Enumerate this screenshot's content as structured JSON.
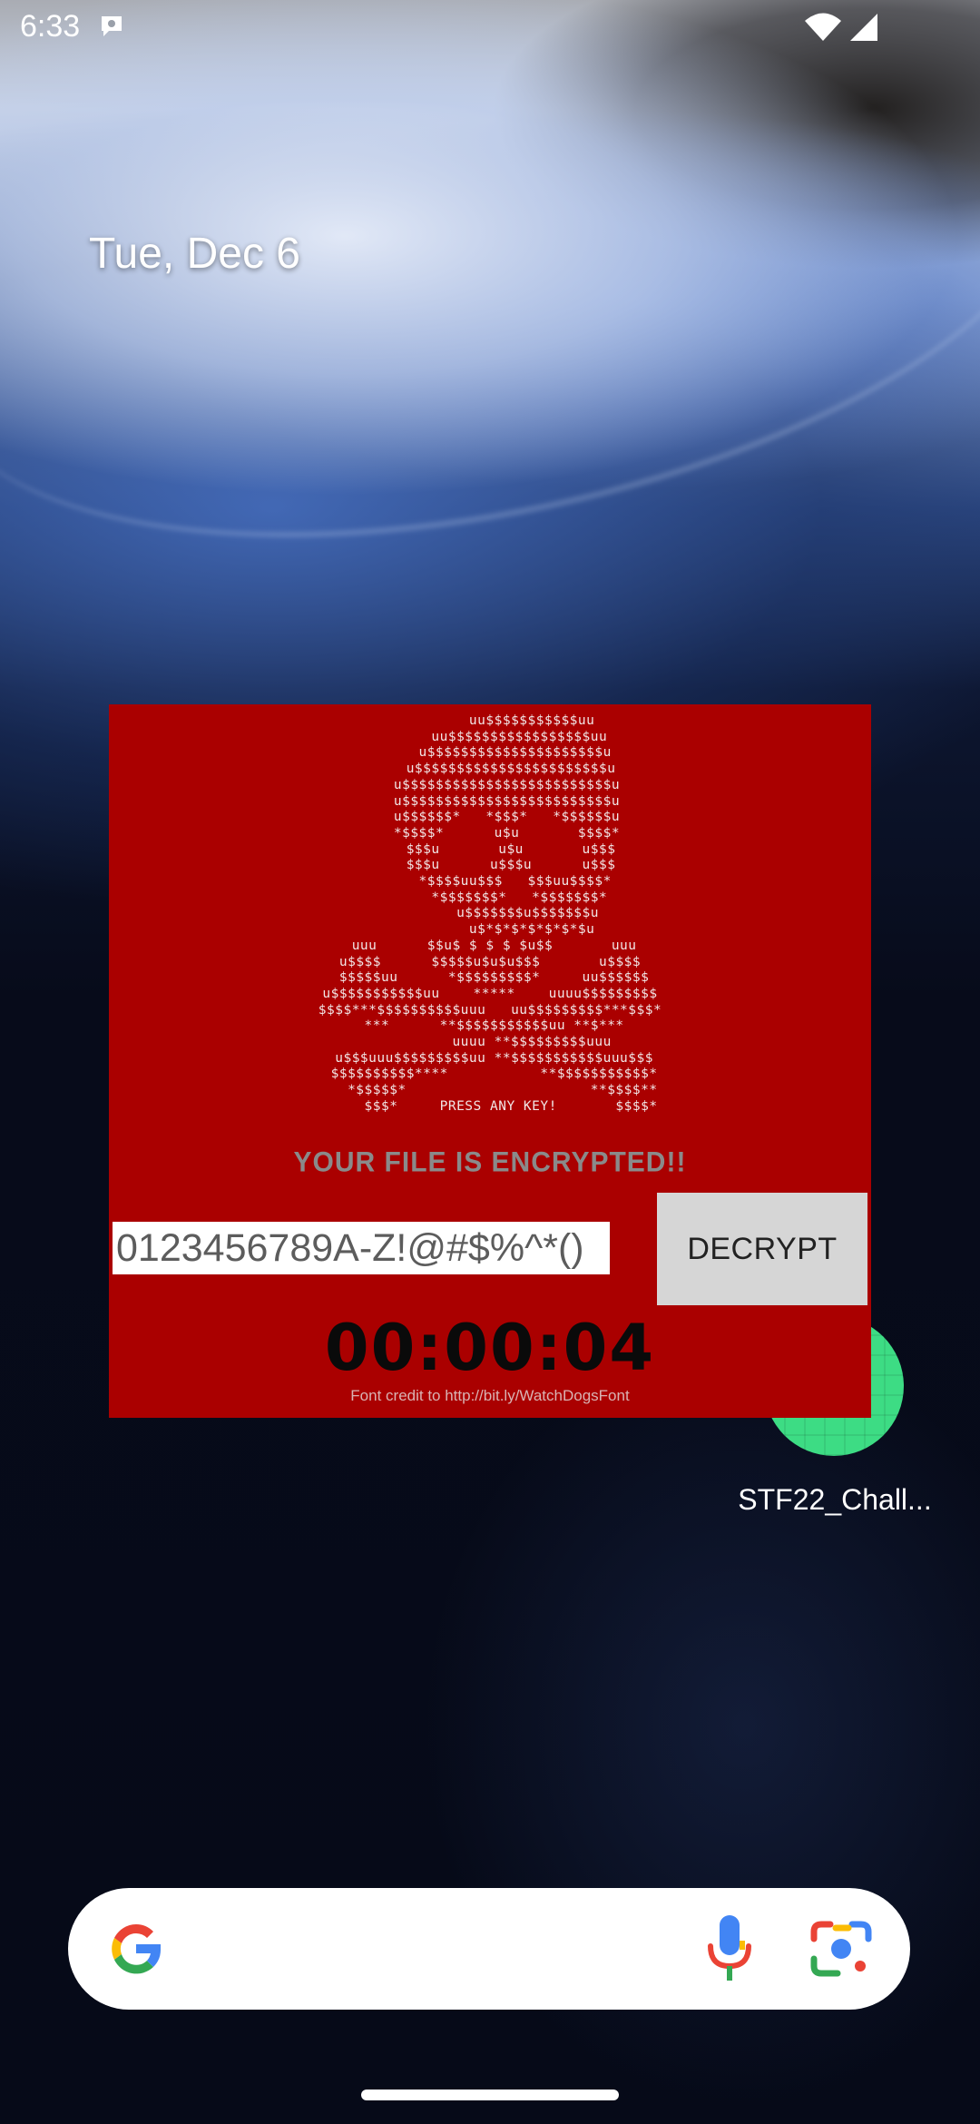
{
  "status_bar": {
    "time": "6:33",
    "notification_icon": "chat-bubble-icon",
    "wifi_icon": "wifi-icon",
    "signal_icon": "cell-signal-icon"
  },
  "home": {
    "date": "Tue, Dec 6",
    "app_label": "STF22_Chall...",
    "app_icon": "android-app-icon"
  },
  "overlay": {
    "skull_ascii": "          uu$$$$$$$$$$$uu\n       uu$$$$$$$$$$$$$$$$$uu\n      u$$$$$$$$$$$$$$$$$$$$$u\n     u$$$$$$$$$$$$$$$$$$$$$$$u\n    u$$$$$$$$$$$$$$$$$$$$$$$$$u\n    u$$$$$$$$$$$$$$$$$$$$$$$$$u\n    u$$$$$$*   *$$$*   *$$$$$$u\n    *$$$$*      u$u       $$$$*\n     $$$u       u$u       u$$$\n     $$$u      u$$$u      u$$$\n      *$$$$uu$$$   $$$uu$$$$*\n       *$$$$$$$*   *$$$$$$$*\n         u$$$$$$$u$$$$$$$u\n          u$*$*$*$*$*$*$u\n uuu      $$u$ $ $ $ $u$$       uuu\nu$$$$      $$$$$u$u$u$$$       u$$$$\n $$$$$uu      *$$$$$$$$$*     uu$$$$$$\nu$$$$$$$$$$$uu    *****    uuuu$$$$$$$$$\n$$$$***$$$$$$$$$$uuu   uu$$$$$$$$$***$$$*\n ***      **$$$$$$$$$$$uu **$***\n          uuuu **$$$$$$$$$uuu\n u$$$uuu$$$$$$$$$uu **$$$$$$$$$$$uuu$$$\n $$$$$$$$$$****           **$$$$$$$$$$$*\n   *$$$$$*                      **$$$$**\n     $$$*     PRESS ANY KEY!       $$$$*",
    "message": "YOUR FILE IS ENCRYPTED!!",
    "key_input_value": "0123456789A-Z!@#$%^*()",
    "decrypt_label": "DECRYPT",
    "countdown": "00:00:04",
    "font_credit": "Font credit to http://bit.ly/WatchDogsFont",
    "background_color": "#aa0000"
  },
  "search_bar": {
    "google_icon": "google-g-icon",
    "mic_icon": "microphone-icon",
    "lens_icon": "google-lens-icon"
  }
}
